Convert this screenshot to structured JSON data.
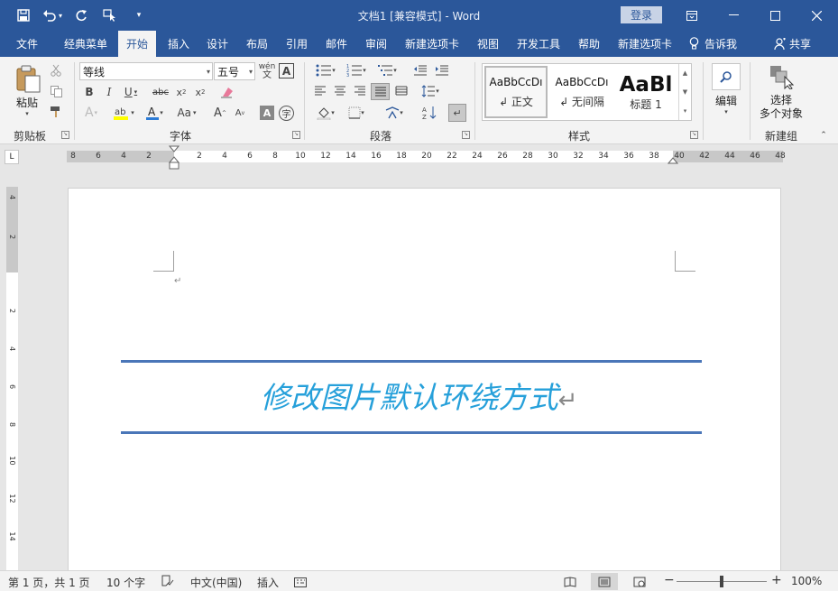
{
  "titlebar": {
    "title": "文档1 [兼容模式]  -  Word",
    "login": "登录",
    "qat": {
      "save_icon": "save-icon",
      "undo_icon": "undo-icon",
      "redo_icon": "redo-icon",
      "touch_icon": "touch-mode-icon",
      "customize_icon": "customize-icon"
    }
  },
  "tabs": [
    "文件",
    "经典菜单",
    "开始",
    "插入",
    "设计",
    "布局",
    "引用",
    "邮件",
    "审阅",
    "新建选项卡",
    "视图",
    "开发工具",
    "帮助",
    "新建选项卡"
  ],
  "active_tab": "开始",
  "tell_me": "告诉我",
  "share": "共享",
  "ribbon": {
    "clipboard": {
      "label": "剪贴板",
      "paste": "粘贴"
    },
    "font": {
      "label": "字体",
      "font_name": "等线",
      "font_size": "五号"
    },
    "paragraph": {
      "label": "段落"
    },
    "styles": {
      "label": "样式",
      "items": [
        {
          "sample": "AaBbCcDı",
          "name": "↲ 正文"
        },
        {
          "sample": "AaBbCcDı",
          "name": "↲ 无间隔"
        },
        {
          "sample": "AaBl",
          "name": "标题 1"
        }
      ]
    },
    "editing": {
      "label": "编辑"
    },
    "select_objects": {
      "label": "选择\n多个对象",
      "line1": "选择",
      "line2": "多个对象"
    },
    "new_group": {
      "label": "新建组"
    }
  },
  "ruler": {
    "h_numbers": [
      "8",
      "6",
      "4",
      "2",
      "2",
      "4",
      "6",
      "8",
      "10",
      "12",
      "14",
      "16",
      "18",
      "20",
      "22",
      "24",
      "26",
      "28",
      "30",
      "32",
      "34",
      "36",
      "38",
      "40",
      "42",
      "44",
      "46",
      "48"
    ],
    "v_numbers": [
      "4",
      "2",
      "2",
      "4",
      "6",
      "8",
      "10",
      "12",
      "14"
    ]
  },
  "document": {
    "heading": "修改图片默认环绕方式",
    "para_mark": "↵"
  },
  "status": {
    "page": "第 1 页，共 1 页",
    "words": "10 个字",
    "language": "中文(中国)",
    "mode": "插入",
    "zoom": "100%"
  }
}
